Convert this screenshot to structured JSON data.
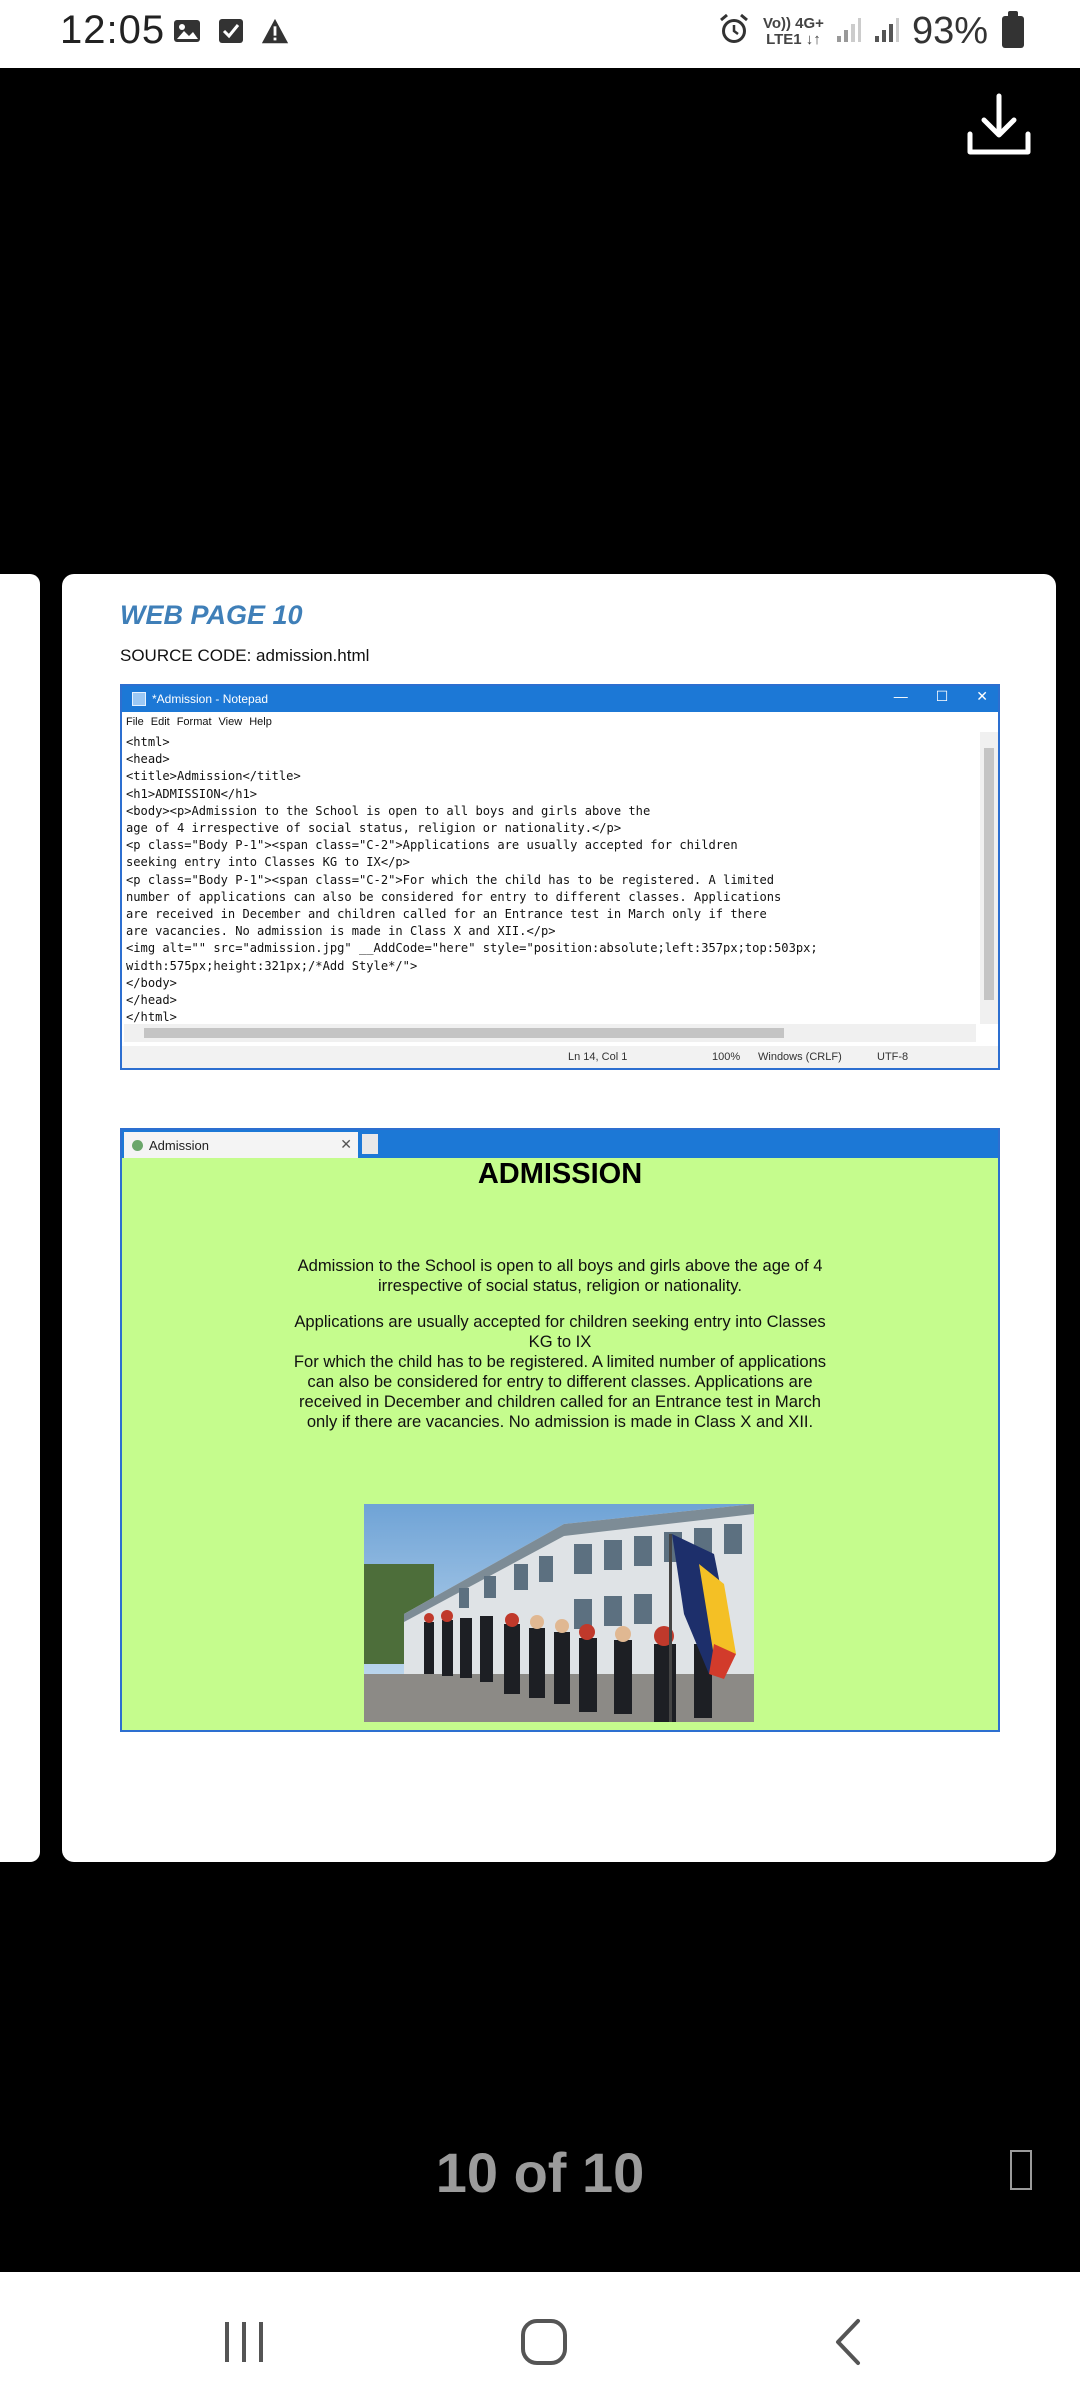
{
  "status_bar": {
    "time": "12:05",
    "icons_left": [
      "image-icon",
      "checkbox-icon",
      "warning-icon"
    ],
    "network": {
      "line1": "Vo)) 4G+",
      "line2": "LTE1 ↓↑"
    },
    "battery": "93%"
  },
  "document": {
    "heading": "WEB PAGE 10",
    "source_label": "SOURCE CODE: admission.html",
    "notepad": {
      "title": "*Admission - Notepad",
      "menu": [
        "File",
        "Edit",
        "Format",
        "View",
        "Help"
      ],
      "code_lines": [
        "<html>",
        "<head>",
        "<title>Admission</title>",
        "<h1>ADMISSION</h1>",
        "<body><p>Admission to the School is open to all boys and girls above the",
        "age of 4 irrespective of social status, religion or nationality.</p>",
        "<p class=\"Body P-1\"><span class=\"C-2\">Applications are usually accepted for children",
        "seeking entry into Classes KG to IX</p>",
        "<p class=\"Body P-1\"><span class=\"C-2\">For which the child has to be registered. A limited",
        "number of applications can also be considered for entry to different classes. Applications",
        "are received in December and children called for an Entrance test in March only if there",
        "are vacancies. No admission is made in Class X and XII.</p>",
        "<img alt=\"\" src=\"admission.jpg\" __AddCode=\"here\" style=\"position:absolute;left:357px;top:503px;",
        "width:575px;height:321px;/*Add Style*/\">",
        "</body>",
        "</head>",
        "</html>"
      ],
      "status": {
        "position": "Ln 14, Col 1",
        "zoom": "100%",
        "line_ending": "Windows (CRLF)",
        "encoding": "UTF-8"
      }
    },
    "browser": {
      "tab_title": "Admission",
      "page_heading": "ADMISSION",
      "paragraphs": [
        "Admission to the School is open to all boys and girls above the age of 4 irrespective of social status, religion or nationality.",
        "Applications are usually accepted for children seeking entry into Classes KG to IX",
        "For which the child has to be registered. A limited number of applications can also be considered for entry to different classes. Applications are received in December and children called for an Entrance test in March only if there are vacancies. No admission is made in Class X and XII."
      ]
    }
  },
  "viewer": {
    "page_counter": "10 of 10"
  },
  "colors": {
    "accent_blue": "#1c78d6",
    "page_background_green": "#c5fc8d",
    "heading_blue": "#3f7fb8"
  }
}
